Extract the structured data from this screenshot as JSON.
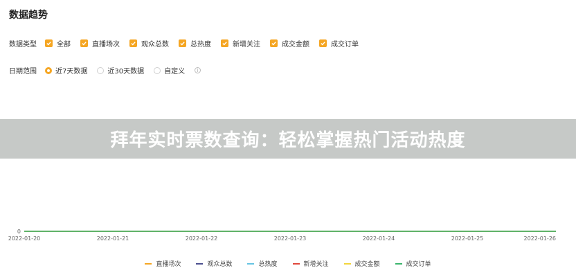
{
  "title": "数据趋势",
  "filters": {
    "type_label": "数据类型",
    "types": [
      "全部",
      "直播场次",
      "观众总数",
      "总热度",
      "新增关注",
      "成交金额",
      "成交订单"
    ],
    "date_label": "日期范围",
    "ranges": [
      "近7天数据",
      "近30天数据",
      "自定义"
    ],
    "selected_range": "近7天数据"
  },
  "banner": {
    "text": "拜年实时票数查询：轻松掌握热门活动热度"
  },
  "colors": {
    "accent": "#f5a623",
    "line": "#3bb56c"
  },
  "chart_data": {
    "type": "line",
    "x": [
      "2022-01-20",
      "2022-01-21",
      "2022-01-22",
      "2022-01-23",
      "2022-01-24",
      "2022-01-25",
      "2022-01-26"
    ],
    "y_ticks": [
      "0"
    ],
    "series": [
      {
        "name": "直播场次",
        "color": "#f5a623",
        "values": [
          0,
          0,
          0,
          0,
          0,
          0,
          0
        ]
      },
      {
        "name": "观众总数",
        "color": "#4b4f8f",
        "values": [
          0,
          0,
          0,
          0,
          0,
          0,
          0
        ]
      },
      {
        "name": "总热度",
        "color": "#66c4e3",
        "values": [
          0,
          0,
          0,
          0,
          0,
          0,
          0
        ]
      },
      {
        "name": "新增关注",
        "color": "#e0473c",
        "values": [
          0,
          0,
          0,
          0,
          0,
          0,
          0
        ]
      },
      {
        "name": "成交金额",
        "color": "#f2d53c",
        "values": [
          0,
          0,
          0,
          0,
          0,
          0,
          0
        ]
      },
      {
        "name": "成交订单",
        "color": "#3bb56c",
        "values": [
          0,
          0,
          0,
          0,
          0,
          0,
          0
        ]
      }
    ]
  }
}
